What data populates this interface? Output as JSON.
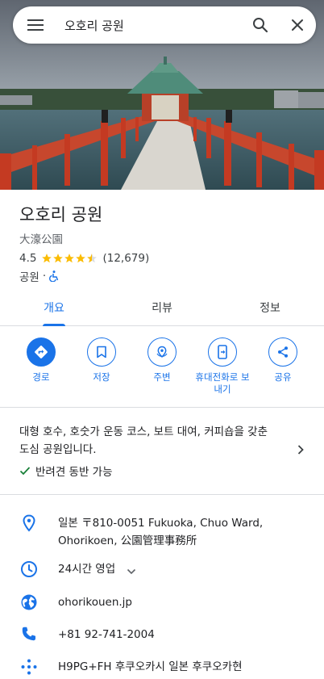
{
  "search": {
    "query": "오호리 공원"
  },
  "place": {
    "title": "오호리 공원",
    "subtitle": "大濠公園",
    "rating": "4.5",
    "rating_value": 4.5,
    "reviews": "(12,679)",
    "category": "공원",
    "separator": "·"
  },
  "tabs": [
    {
      "label": "개요"
    },
    {
      "label": "리뷰"
    },
    {
      "label": "정보"
    }
  ],
  "actions": [
    {
      "label": "경로",
      "icon": "directions-icon"
    },
    {
      "label": "저장",
      "icon": "bookmark-icon"
    },
    {
      "label": "주변",
      "icon": "nearby-icon"
    },
    {
      "label": "휴대전화로 보내기",
      "icon": "send-to-phone-icon"
    },
    {
      "label": "공유",
      "icon": "share-icon"
    }
  ],
  "description": {
    "text": "대형 호수, 호숫가 운동 코스, 보트 대여, 커피숍을 갖춘 도심 공원입니다.",
    "pet_friendly": "반려견 동반 가능"
  },
  "info": {
    "address": "일본 〒810-0051 Fukuoka, Chuo Ward, Ohorikoen, 公園管理事務所",
    "hours": "24시간 영업",
    "website": "ohorikouen.jp",
    "phone": "+81 92-741-2004",
    "plus_code": "H9PG+FH 후쿠오카시 일본 후쿠오카현"
  },
  "colors": {
    "accent": "#1a73e8",
    "star": "#fbbc04",
    "open": "#188038"
  }
}
